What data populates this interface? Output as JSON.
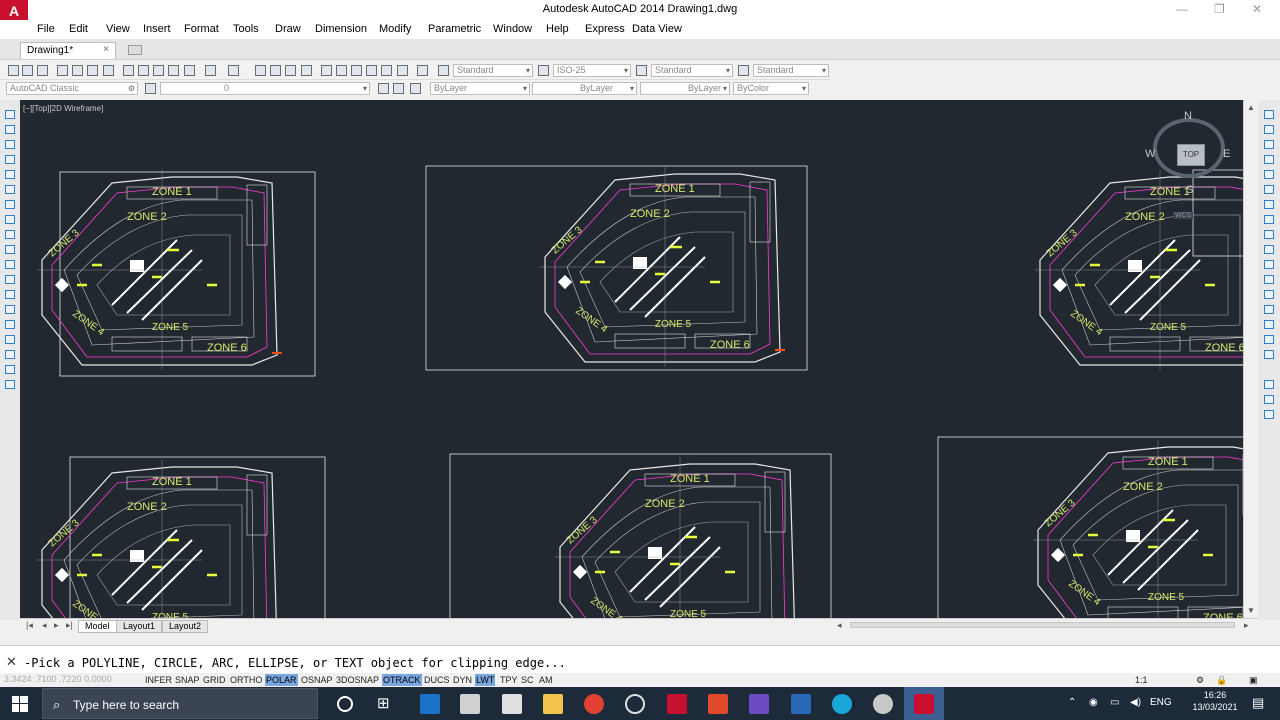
{
  "window": {
    "title": "Autodesk AutoCAD 2014    Drawing1.dwg",
    "app_logo": "A",
    "controls": [
      "—",
      "❐",
      "✕"
    ]
  },
  "menu": {
    "items": [
      "File",
      "Edit",
      "View",
      "Insert",
      "Format",
      "Tools",
      "Draw",
      "Dimension",
      "Modify",
      "Parametric",
      "Window",
      "Help",
      "Express",
      "Data View"
    ]
  },
  "doc_tab": {
    "label": "Drawing1*",
    "close": "×"
  },
  "toolbar1": {
    "text_style": "Standard",
    "dim_style": "ISO-25",
    "table_style": "Standard",
    "mleader_style": "Standard"
  },
  "toolbar2": {
    "workspace": "AutoCAD Classic",
    "layer": "0",
    "color": "ByLayer",
    "linetype": "ByLayer",
    "lineweight": "ByLayer",
    "plotstyle": "ByColor"
  },
  "viewport": {
    "label": "[−][Top][2D Wireframe]",
    "bg": "#212830",
    "viewcube": {
      "n": "N",
      "s": "S",
      "e": "E",
      "w": "W",
      "face": "TOP",
      "wcs": "WCS"
    },
    "zone_labels": [
      "ZONE 1",
      "ZONE 2",
      "ZONE 3",
      "ZONE 4",
      "ZONE 5",
      "ZONE 6"
    ]
  },
  "layout_tabs": {
    "model": "Model",
    "layout1": "Layout1",
    "layout2": "Layout2"
  },
  "command": {
    "prompt": "-Pick a POLYLINE, CIRCLE, ARC, ELLIPSE, or TEXT object for clipping edge..."
  },
  "status": {
    "coords": "3.3424 .7100 .7220 0.0000",
    "buttons": [
      {
        "label": "INFER",
        "on": false
      },
      {
        "label": "SNAP",
        "on": false
      },
      {
        "label": "GRID",
        "on": false
      },
      {
        "label": "ORTHO",
        "on": false
      },
      {
        "label": "POLAR",
        "on": true
      },
      {
        "label": "OSNAP",
        "on": false
      },
      {
        "label": "3DOSNAP",
        "on": false
      },
      {
        "label": "OTRACK",
        "on": true
      },
      {
        "label": "DUCS",
        "on": false
      },
      {
        "label": "DYN",
        "on": false
      },
      {
        "label": "LWT",
        "on": true
      },
      {
        "label": "TPY",
        "on": false
      },
      {
        "label": "SC",
        "on": false
      },
      {
        "label": "AM",
        "on": false
      }
    ],
    "scale": "1:1"
  },
  "taskbar": {
    "search_placeholder": "Type here to search",
    "time": "16:26",
    "date": "13/03/2021",
    "lang": "ENG"
  }
}
